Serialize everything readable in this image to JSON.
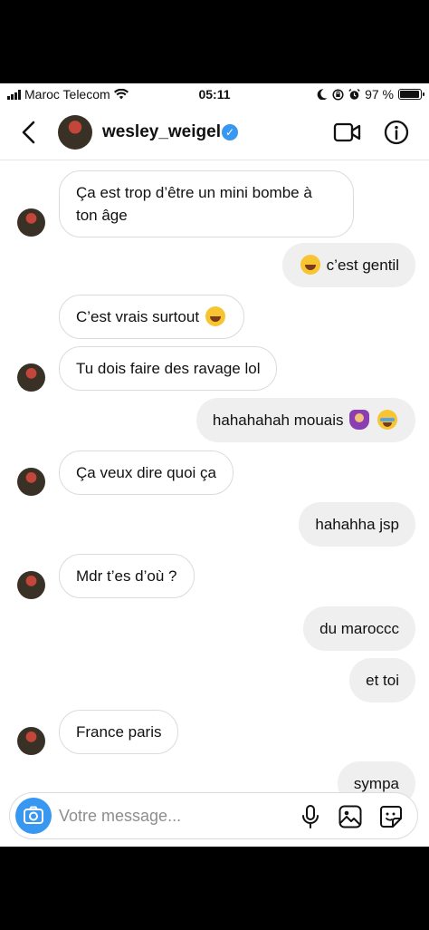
{
  "status_bar": {
    "carrier": "Maroc Telecom",
    "time": "05:11",
    "battery": "97 %"
  },
  "header": {
    "username": "wesley_weigel",
    "verified_mark": "✓"
  },
  "messages": [
    {
      "dir": "in",
      "text": "Ça est trop d’être un mini bombe à ton âge"
    },
    {
      "dir": "out",
      "text": "c’est gentil",
      "emoji_before": "laughing-crying-face"
    },
    {
      "dir": "in",
      "text": "C’est vrais surtout",
      "emoji_after": "laughing-crying-face"
    },
    {
      "dir": "in",
      "text": "Tu dois faire des ravage lol"
    },
    {
      "dir": "out",
      "text": "hahahahah mouais",
      "emoji_after": [
        "woman-shrugging",
        "crying-face"
      ]
    },
    {
      "dir": "in",
      "text": "Ça veux dire quoi ça"
    },
    {
      "dir": "out",
      "text": "hahahha jsp"
    },
    {
      "dir": "in",
      "text": "Mdr t’es d’où ?"
    },
    {
      "dir": "out",
      "text": "du maroccc"
    },
    {
      "dir": "out",
      "text": "et toi"
    },
    {
      "dir": "in",
      "text": "France paris"
    },
    {
      "dir": "out",
      "text": "sympa"
    }
  ],
  "composer": {
    "placeholder": "Votre message..."
  },
  "colors": {
    "accent": "#3897f0",
    "incoming_border": "#dbdbdb",
    "outgoing_bg": "#efefef"
  }
}
